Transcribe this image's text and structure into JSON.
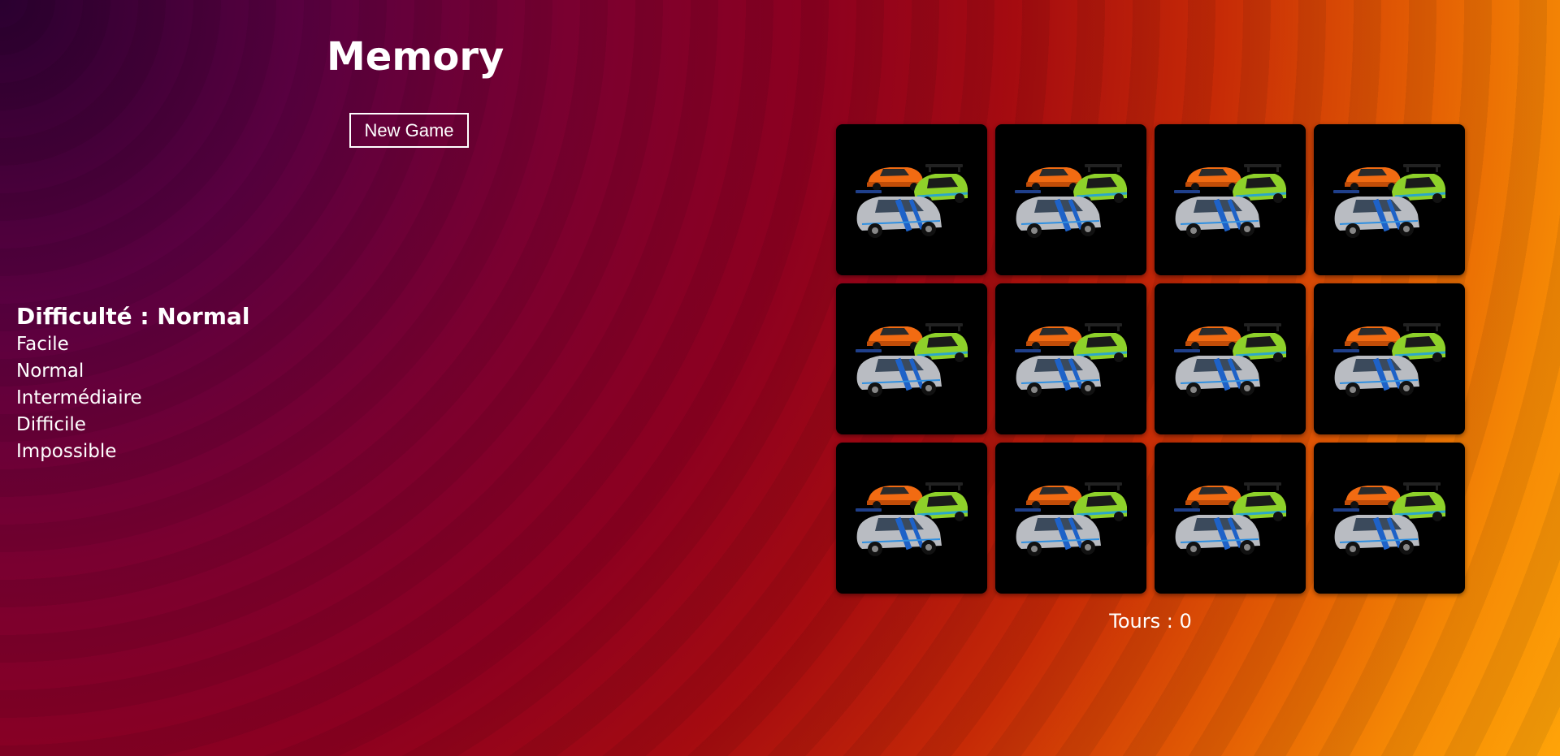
{
  "header": {
    "title": "Memory",
    "new_game_label": "New Game"
  },
  "difficulty": {
    "heading": "Difficulté : Normal",
    "options": [
      "Facile",
      "Normal",
      "Intermédiaire",
      "Difficile",
      "Impossible"
    ]
  },
  "board": {
    "rows": 3,
    "columns": 4,
    "card_back_icon": "three-sports-cars-icon",
    "card_back_color": "#000000"
  },
  "status": {
    "turns_label": "Tours : 0"
  }
}
